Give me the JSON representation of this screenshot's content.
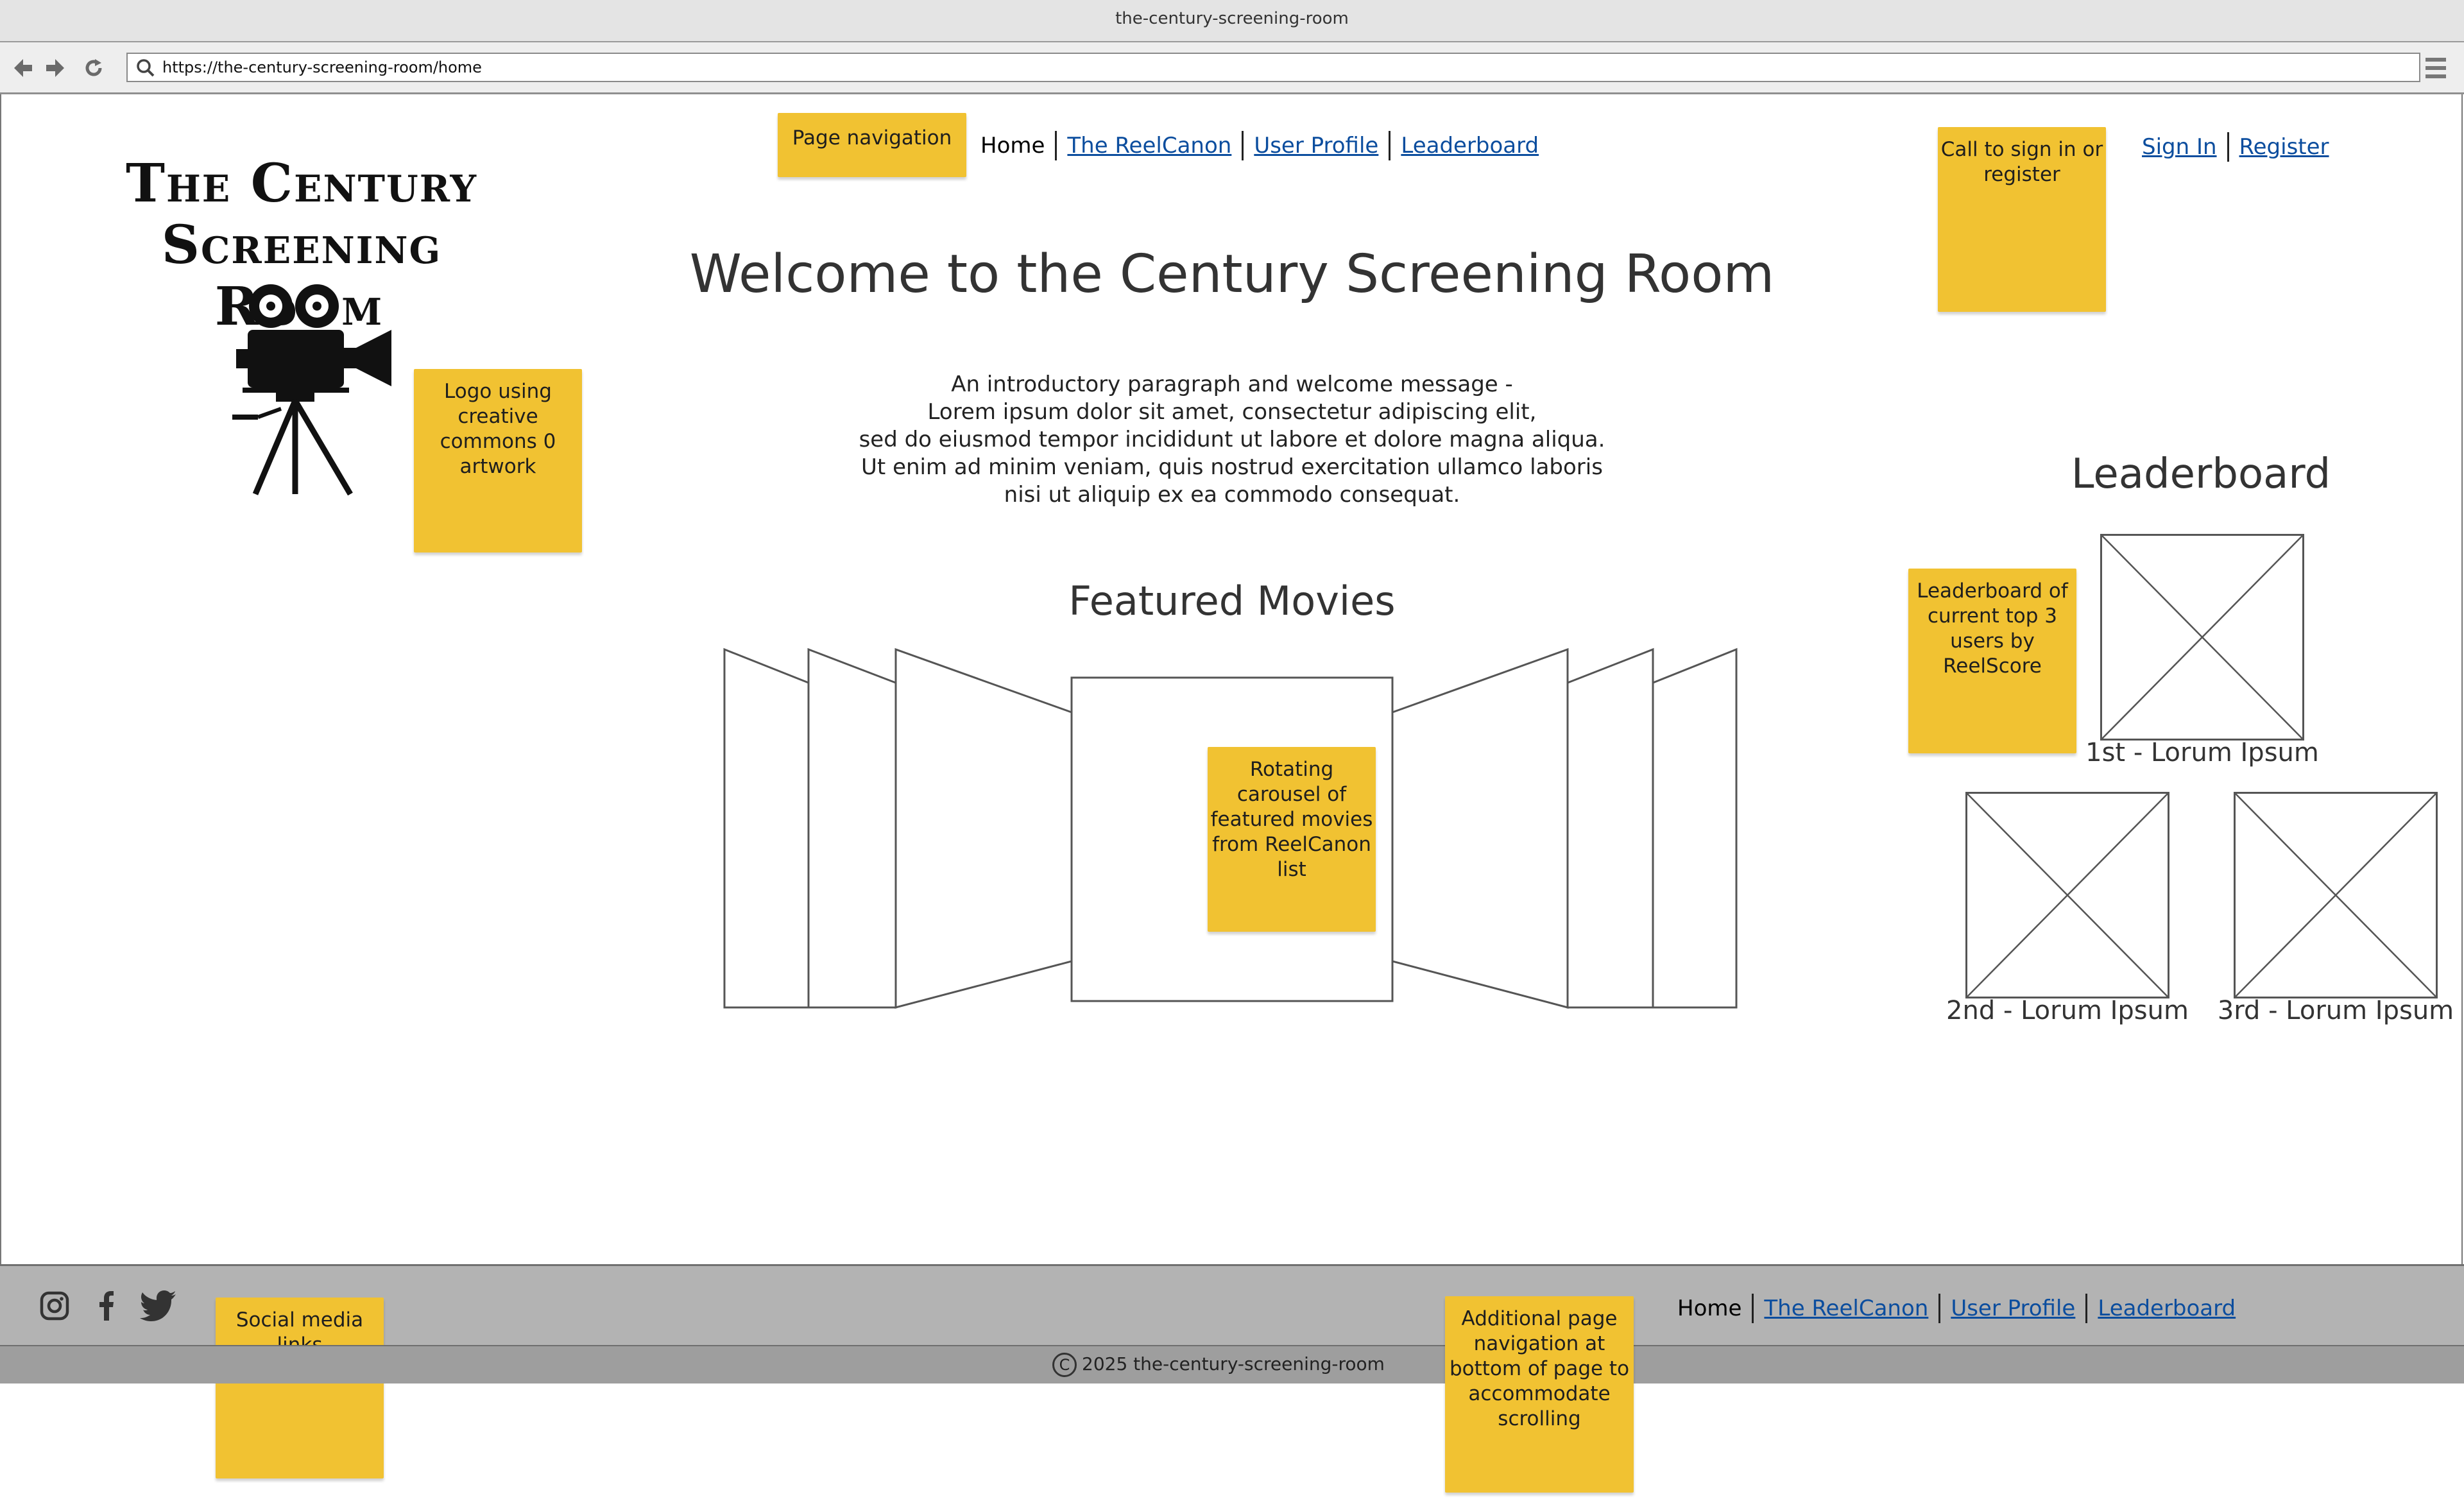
{
  "browser": {
    "window_title": "the-century-screening-room",
    "url": "https://the-century-screening-room/home",
    "icons": [
      "back-icon",
      "forward-icon",
      "refresh-icon",
      "search-icon",
      "menu-icon"
    ]
  },
  "logo": {
    "line1": "The Century",
    "line2": "Screening",
    "line3": "Room",
    "graphic": "film-camera-on-tripod-icon"
  },
  "header_nav": {
    "items": [
      {
        "label": "Home",
        "current": true
      },
      {
        "label": "The ReelCanon"
      },
      {
        "label": "User Profile"
      },
      {
        "label": "Leaderboard"
      }
    ]
  },
  "auth": {
    "sign_in": "Sign In",
    "register": "Register"
  },
  "main": {
    "welcome_title": "Welcome to the Century Screening Room",
    "intro_lines": [
      "An introductory paragraph and welcome message -",
      "Lorem ipsum dolor sit amet, consectetur adipiscing elit,",
      "sed do eiusmod tempor incididunt ut labore et dolore magna aliqua.",
      "Ut enim ad minim veniam, quis nostrud exercitation ullamco laboris",
      "nisi ut aliquip ex ea commodo consequat."
    ],
    "featured_title": "Featured Movies"
  },
  "leaderboard": {
    "title": "Leaderboard",
    "entries": [
      {
        "label": "1st - Lorum Ipsum"
      },
      {
        "label": "2nd - Lorum Ipsum"
      },
      {
        "label": "3rd - Lorum Ipsum"
      }
    ]
  },
  "footer": {
    "social_icons": [
      "instagram-icon",
      "facebook-icon",
      "twitter-icon"
    ],
    "nav": [
      {
        "label": "Home",
        "current": true
      },
      {
        "label": "The ReelCanon"
      },
      {
        "label": "User Profile"
      },
      {
        "label": "Leaderboard"
      }
    ],
    "copyright_symbol": "C",
    "copyright_text": "2025 the-century-screening-room"
  },
  "annotations": {
    "logo_note": "Logo using creative commons 0 artwork",
    "nav_note": "Page navigation",
    "signin_note": "Call to sign in or register",
    "leaderboard_note": "Leaderboard of current top 3 users by ReelScore",
    "carousel_note": "Rotating carousel of featured movies from ReelCanon list",
    "social_note": "Social media links",
    "footer_nav_note": "Additional page navigation at bottom of page to accommodate scrolling"
  },
  "colors": {
    "sticky_note": "#f1c232",
    "link": "#0b4d9e",
    "footer": "#b3b3b3",
    "copyright_bar": "#9e9e9e"
  }
}
